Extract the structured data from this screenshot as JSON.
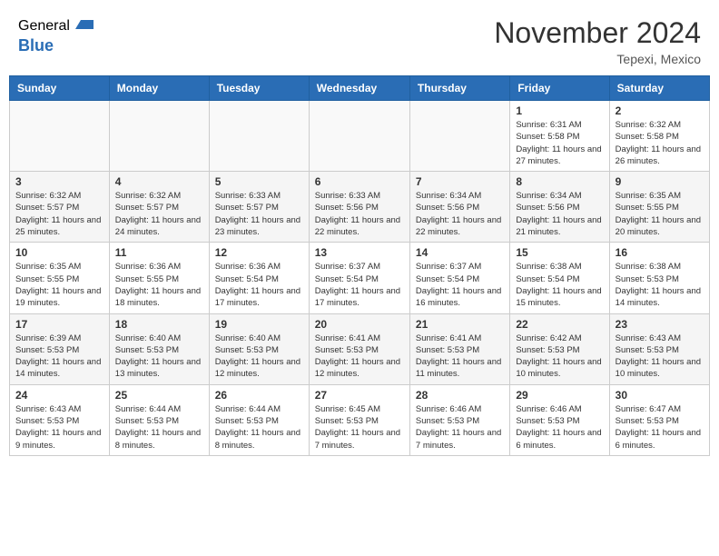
{
  "header": {
    "logo_general": "General",
    "logo_blue": "Blue",
    "month_title": "November 2024",
    "location": "Tepexi, Mexico"
  },
  "days_of_week": [
    "Sunday",
    "Monday",
    "Tuesday",
    "Wednesday",
    "Thursday",
    "Friday",
    "Saturday"
  ],
  "weeks": [
    {
      "days": [
        {
          "num": "",
          "sunrise": "",
          "sunset": "",
          "daylight": ""
        },
        {
          "num": "",
          "sunrise": "",
          "sunset": "",
          "daylight": ""
        },
        {
          "num": "",
          "sunrise": "",
          "sunset": "",
          "daylight": ""
        },
        {
          "num": "",
          "sunrise": "",
          "sunset": "",
          "daylight": ""
        },
        {
          "num": "",
          "sunrise": "",
          "sunset": "",
          "daylight": ""
        },
        {
          "num": "1",
          "sunrise": "Sunrise: 6:31 AM",
          "sunset": "Sunset: 5:58 PM",
          "daylight": "Daylight: 11 hours and 27 minutes."
        },
        {
          "num": "2",
          "sunrise": "Sunrise: 6:32 AM",
          "sunset": "Sunset: 5:58 PM",
          "daylight": "Daylight: 11 hours and 26 minutes."
        }
      ]
    },
    {
      "days": [
        {
          "num": "3",
          "sunrise": "Sunrise: 6:32 AM",
          "sunset": "Sunset: 5:57 PM",
          "daylight": "Daylight: 11 hours and 25 minutes."
        },
        {
          "num": "4",
          "sunrise": "Sunrise: 6:32 AM",
          "sunset": "Sunset: 5:57 PM",
          "daylight": "Daylight: 11 hours and 24 minutes."
        },
        {
          "num": "5",
          "sunrise": "Sunrise: 6:33 AM",
          "sunset": "Sunset: 5:57 PM",
          "daylight": "Daylight: 11 hours and 23 minutes."
        },
        {
          "num": "6",
          "sunrise": "Sunrise: 6:33 AM",
          "sunset": "Sunset: 5:56 PM",
          "daylight": "Daylight: 11 hours and 22 minutes."
        },
        {
          "num": "7",
          "sunrise": "Sunrise: 6:34 AM",
          "sunset": "Sunset: 5:56 PM",
          "daylight": "Daylight: 11 hours and 22 minutes."
        },
        {
          "num": "8",
          "sunrise": "Sunrise: 6:34 AM",
          "sunset": "Sunset: 5:56 PM",
          "daylight": "Daylight: 11 hours and 21 minutes."
        },
        {
          "num": "9",
          "sunrise": "Sunrise: 6:35 AM",
          "sunset": "Sunset: 5:55 PM",
          "daylight": "Daylight: 11 hours and 20 minutes."
        }
      ]
    },
    {
      "days": [
        {
          "num": "10",
          "sunrise": "Sunrise: 6:35 AM",
          "sunset": "Sunset: 5:55 PM",
          "daylight": "Daylight: 11 hours and 19 minutes."
        },
        {
          "num": "11",
          "sunrise": "Sunrise: 6:36 AM",
          "sunset": "Sunset: 5:55 PM",
          "daylight": "Daylight: 11 hours and 18 minutes."
        },
        {
          "num": "12",
          "sunrise": "Sunrise: 6:36 AM",
          "sunset": "Sunset: 5:54 PM",
          "daylight": "Daylight: 11 hours and 17 minutes."
        },
        {
          "num": "13",
          "sunrise": "Sunrise: 6:37 AM",
          "sunset": "Sunset: 5:54 PM",
          "daylight": "Daylight: 11 hours and 17 minutes."
        },
        {
          "num": "14",
          "sunrise": "Sunrise: 6:37 AM",
          "sunset": "Sunset: 5:54 PM",
          "daylight": "Daylight: 11 hours and 16 minutes."
        },
        {
          "num": "15",
          "sunrise": "Sunrise: 6:38 AM",
          "sunset": "Sunset: 5:54 PM",
          "daylight": "Daylight: 11 hours and 15 minutes."
        },
        {
          "num": "16",
          "sunrise": "Sunrise: 6:38 AM",
          "sunset": "Sunset: 5:53 PM",
          "daylight": "Daylight: 11 hours and 14 minutes."
        }
      ]
    },
    {
      "days": [
        {
          "num": "17",
          "sunrise": "Sunrise: 6:39 AM",
          "sunset": "Sunset: 5:53 PM",
          "daylight": "Daylight: 11 hours and 14 minutes."
        },
        {
          "num": "18",
          "sunrise": "Sunrise: 6:40 AM",
          "sunset": "Sunset: 5:53 PM",
          "daylight": "Daylight: 11 hours and 13 minutes."
        },
        {
          "num": "19",
          "sunrise": "Sunrise: 6:40 AM",
          "sunset": "Sunset: 5:53 PM",
          "daylight": "Daylight: 11 hours and 12 minutes."
        },
        {
          "num": "20",
          "sunrise": "Sunrise: 6:41 AM",
          "sunset": "Sunset: 5:53 PM",
          "daylight": "Daylight: 11 hours and 12 minutes."
        },
        {
          "num": "21",
          "sunrise": "Sunrise: 6:41 AM",
          "sunset": "Sunset: 5:53 PM",
          "daylight": "Daylight: 11 hours and 11 minutes."
        },
        {
          "num": "22",
          "sunrise": "Sunrise: 6:42 AM",
          "sunset": "Sunset: 5:53 PM",
          "daylight": "Daylight: 11 hours and 10 minutes."
        },
        {
          "num": "23",
          "sunrise": "Sunrise: 6:43 AM",
          "sunset": "Sunset: 5:53 PM",
          "daylight": "Daylight: 11 hours and 10 minutes."
        }
      ]
    },
    {
      "days": [
        {
          "num": "24",
          "sunrise": "Sunrise: 6:43 AM",
          "sunset": "Sunset: 5:53 PM",
          "daylight": "Daylight: 11 hours and 9 minutes."
        },
        {
          "num": "25",
          "sunrise": "Sunrise: 6:44 AM",
          "sunset": "Sunset: 5:53 PM",
          "daylight": "Daylight: 11 hours and 8 minutes."
        },
        {
          "num": "26",
          "sunrise": "Sunrise: 6:44 AM",
          "sunset": "Sunset: 5:53 PM",
          "daylight": "Daylight: 11 hours and 8 minutes."
        },
        {
          "num": "27",
          "sunrise": "Sunrise: 6:45 AM",
          "sunset": "Sunset: 5:53 PM",
          "daylight": "Daylight: 11 hours and 7 minutes."
        },
        {
          "num": "28",
          "sunrise": "Sunrise: 6:46 AM",
          "sunset": "Sunset: 5:53 PM",
          "daylight": "Daylight: 11 hours and 7 minutes."
        },
        {
          "num": "29",
          "sunrise": "Sunrise: 6:46 AM",
          "sunset": "Sunset: 5:53 PM",
          "daylight": "Daylight: 11 hours and 6 minutes."
        },
        {
          "num": "30",
          "sunrise": "Sunrise: 6:47 AM",
          "sunset": "Sunset: 5:53 PM",
          "daylight": "Daylight: 11 hours and 6 minutes."
        }
      ]
    }
  ]
}
